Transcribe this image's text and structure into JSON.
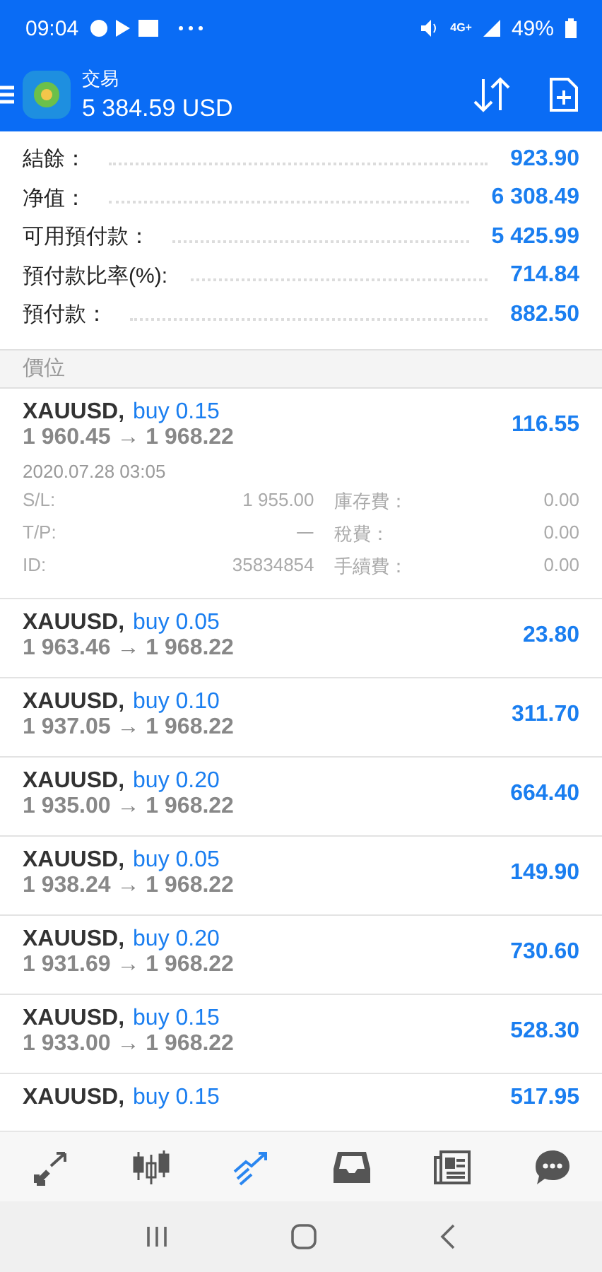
{
  "status_bar": {
    "time": "09:04",
    "network": "4G+",
    "battery": "49%"
  },
  "header": {
    "title": "交易",
    "balance": "5 384.59 USD"
  },
  "summary": [
    {
      "label": "結餘：",
      "value": "923.90"
    },
    {
      "label": "净值：",
      "value": "6 308.49"
    },
    {
      "label": "可用預付款：",
      "value": "5 425.99"
    },
    {
      "label": "預付款比率(%):",
      "value": "714.84"
    },
    {
      "label": "預付款：",
      "value": "882.50"
    }
  ],
  "positions_title": "價位",
  "positions": [
    {
      "symbol": "XAUUSD,",
      "order": "buy 0.15",
      "prices": "1 960.45 → 1 968.22",
      "profit": "116.55",
      "expanded": true,
      "time": "2020.07.28 03:05",
      "details": [
        {
          "label": "S/L:",
          "value": "1 955.00",
          "label2": "庫存費：",
          "value2": "0.00"
        },
        {
          "label": "T/P:",
          "value": "一",
          "label2": "稅費：",
          "value2": "0.00"
        },
        {
          "label": "ID:",
          "value": "35834854",
          "label2": "手續費：",
          "value2": "0.00"
        }
      ]
    },
    {
      "symbol": "XAUUSD,",
      "order": "buy 0.05",
      "prices": "1 963.46 → 1 968.22",
      "profit": "23.80",
      "expanded": false
    },
    {
      "symbol": "XAUUSD,",
      "order": "buy 0.10",
      "prices": "1 937.05 → 1 968.22",
      "profit": "311.70",
      "expanded": false
    },
    {
      "symbol": "XAUUSD,",
      "order": "buy 0.20",
      "prices": "1 935.00 → 1 968.22",
      "profit": "664.40",
      "expanded": false
    },
    {
      "symbol": "XAUUSD,",
      "order": "buy 0.05",
      "prices": "1 938.24 → 1 968.22",
      "profit": "149.90",
      "expanded": false
    },
    {
      "symbol": "XAUUSD,",
      "order": "buy 0.20",
      "prices": "1 931.69 → 1 968.22",
      "profit": "730.60",
      "expanded": false
    },
    {
      "symbol": "XAUUSD,",
      "order": "buy 0.15",
      "prices": "1 933.00 → 1 968.22",
      "profit": "528.30",
      "expanded": false
    },
    {
      "symbol": "XAUUSD,",
      "order": "buy 0.15",
      "profit": "517.95",
      "expanded": false
    }
  ],
  "bottom_nav": [
    {
      "selected": false
    },
    {
      "selected": false
    },
    {
      "selected": true
    },
    {
      "selected": false
    },
    {
      "selected": false
    },
    {
      "selected": false
    }
  ]
}
